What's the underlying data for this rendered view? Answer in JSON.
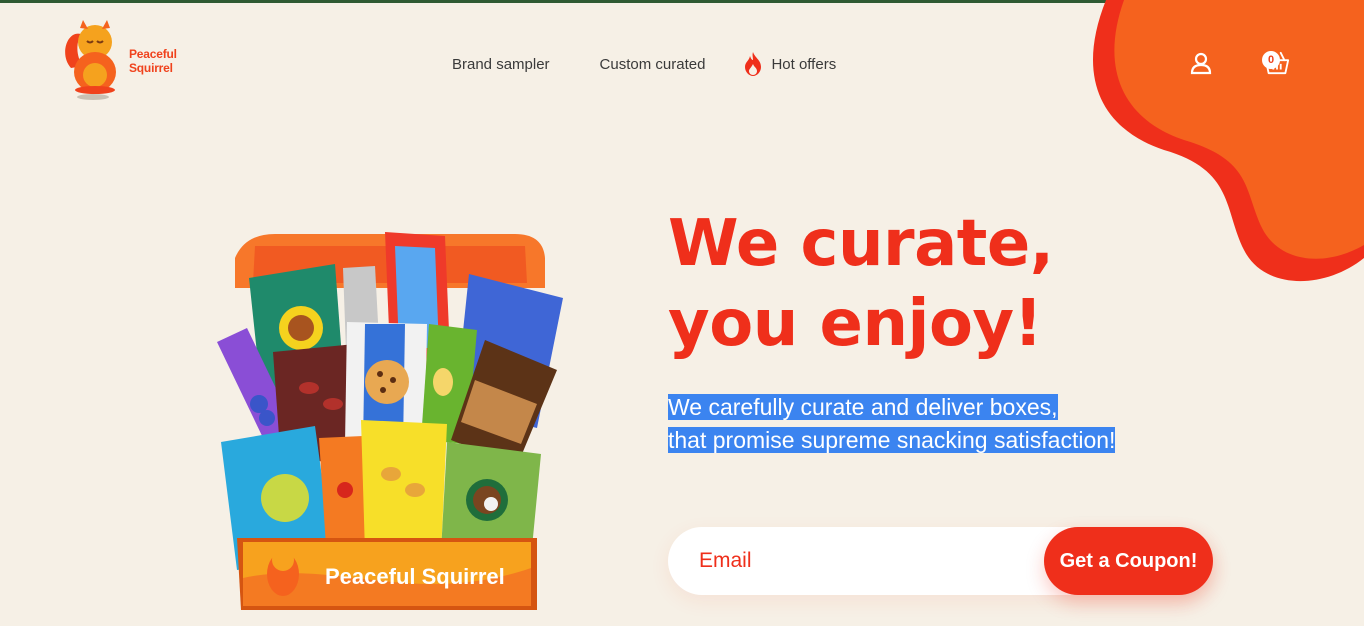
{
  "brand": {
    "name_line1": "Peaceful",
    "name_line2": "Squirrel",
    "color": "#f0421c"
  },
  "nav": {
    "items": [
      {
        "label": "Brand sampler"
      },
      {
        "label": "Custom curated"
      },
      {
        "label": "Hot offers",
        "icon": "fire-icon"
      }
    ]
  },
  "header": {
    "account_icon": "user-icon",
    "cart_icon": "basket-icon",
    "cart_count": "0"
  },
  "hero": {
    "title_line1": "We curate,",
    "title_line2": "you enjoy!",
    "subtitle_line1": "We carefully curate and deliver boxes,",
    "subtitle_line2": "that promise supreme snacking satisfaction!",
    "box_label": "Peaceful Squirrel"
  },
  "signup": {
    "placeholder": "Email",
    "button_label": "Get a Coupon!"
  },
  "colors": {
    "accent": "#ef2f1b",
    "orange": "#f5621e",
    "background": "#f6f0e6",
    "selection": "#3b84f0"
  }
}
